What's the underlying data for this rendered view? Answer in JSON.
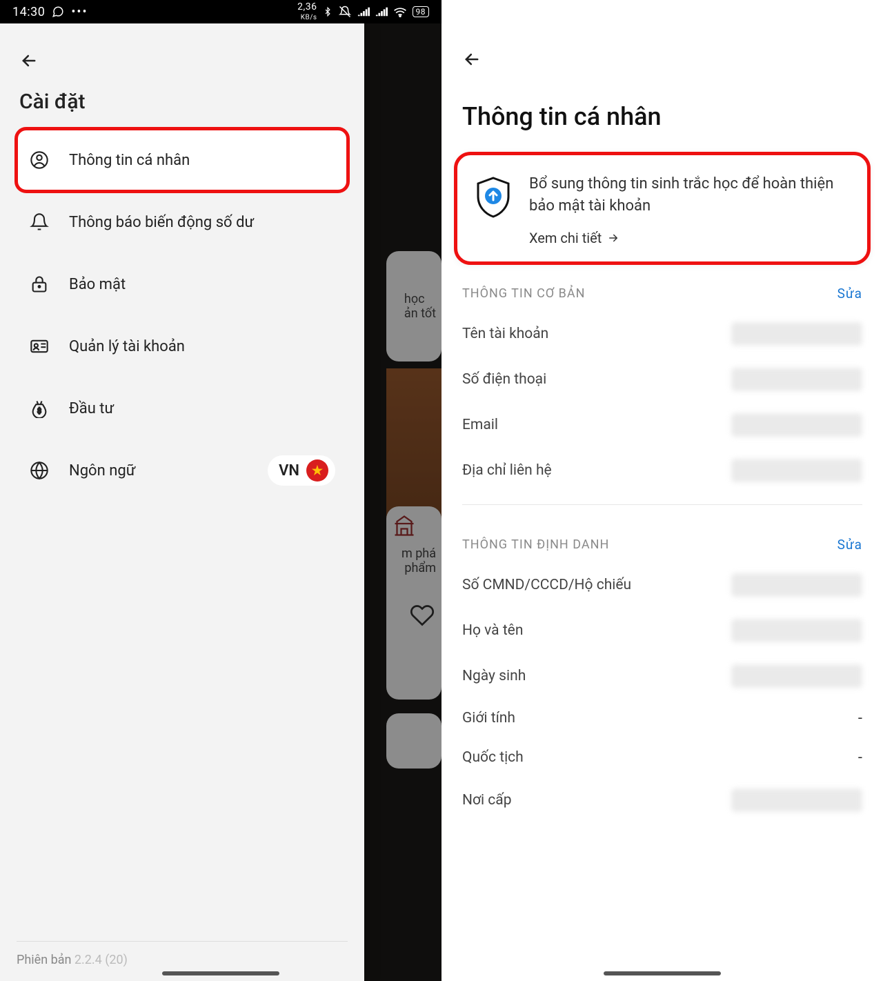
{
  "statusbar": {
    "time": "14:30",
    "net_rate": "2,36",
    "net_unit": "KB/s",
    "battery": "98"
  },
  "left": {
    "title": "Cài đặt",
    "menu": [
      {
        "label": "Thông tin cá nhân"
      },
      {
        "label": "Thông báo biến động số dư"
      },
      {
        "label": "Bảo mật"
      },
      {
        "label": "Quản lý tài khoản"
      },
      {
        "label": "Đầu tư"
      },
      {
        "label": "Ngôn ngữ"
      }
    ],
    "lang_code": "VN",
    "version_label": "Phiên bản",
    "version_value": "2.2.4 (20)",
    "bg_hint1a": "học",
    "bg_hint1b": "ản tốt",
    "bg_hint2a": "m phá",
    "bg_hint2b": "phẩm"
  },
  "right": {
    "title": "Thông tin cá nhân",
    "promo_text": "Bổ sung thông tin sinh trắc học để hoàn thiện bảo mật tài khoản",
    "promo_link": "Xem chi tiết",
    "sections": {
      "basic": {
        "label": "THÔNG TIN CƠ BẢN",
        "edit": "Sửa"
      },
      "ident": {
        "label": "THÔNG TIN ĐỊNH DANH",
        "edit": "Sửa"
      }
    },
    "fields": {
      "account_name": "Tên tài khoản",
      "phone": "Số điện thoại",
      "email": "Email",
      "address": "Địa chỉ liên hệ",
      "id_number": "Số CMND/CCCD/Hộ chiếu",
      "fullname": "Họ và tên",
      "dob": "Ngày sinh",
      "gender": "Giới tính",
      "nationality": "Quốc tịch",
      "issue_place": "Nơi cấp"
    },
    "dash": "-"
  }
}
